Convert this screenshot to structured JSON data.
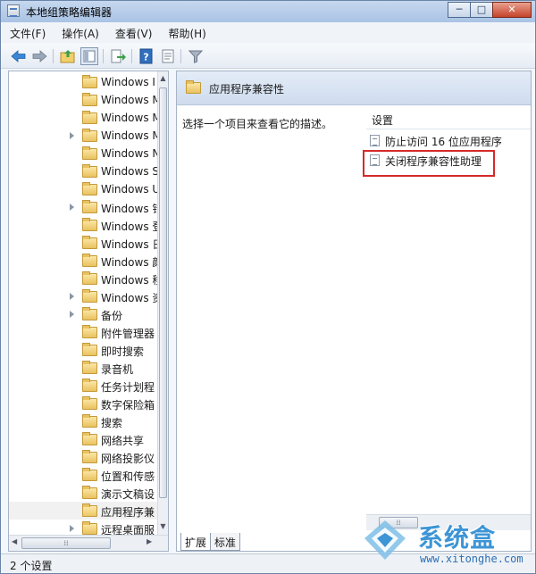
{
  "window": {
    "title": "本地组策略编辑器",
    "buttons": {
      "minimize": "─",
      "maximize": "□",
      "close": "✕"
    }
  },
  "menu": [
    {
      "id": "file",
      "label": "文件(F)"
    },
    {
      "id": "action",
      "label": "操作(A)"
    },
    {
      "id": "view",
      "label": "查看(V)"
    },
    {
      "id": "help",
      "label": "帮助(H)"
    }
  ],
  "toolbar": {
    "icons": [
      "back-arrow-icon",
      "forward-arrow-icon",
      "up-folder-icon",
      "show-hide-tree-icon",
      "export-list-icon",
      "help-icon",
      "properties-icon",
      "filter-icon"
    ]
  },
  "tree": {
    "items": [
      {
        "label": "Windows I",
        "expandable": false
      },
      {
        "label": "Windows M",
        "expandable": false
      },
      {
        "label": "Windows M",
        "expandable": false
      },
      {
        "label": "Windows M",
        "expandable": true
      },
      {
        "label": "Windows N",
        "expandable": false
      },
      {
        "label": "Windows S",
        "expandable": false
      },
      {
        "label": "Windows U",
        "expandable": false
      },
      {
        "label": "Windows 错",
        "expandable": true
      },
      {
        "label": "Windows 登",
        "expandable": false
      },
      {
        "label": "Windows 日",
        "expandable": false
      },
      {
        "label": "Windows 颜",
        "expandable": false
      },
      {
        "label": "Windows 移",
        "expandable": false
      },
      {
        "label": "Windows 资",
        "expandable": true
      },
      {
        "label": "备份",
        "expandable": true
      },
      {
        "label": "附件管理器",
        "expandable": false
      },
      {
        "label": "即时搜索",
        "expandable": false
      },
      {
        "label": "录音机",
        "expandable": false
      },
      {
        "label": "任务计划程",
        "expandable": false
      },
      {
        "label": "数字保险箱",
        "expandable": false
      },
      {
        "label": "搜索",
        "expandable": false
      },
      {
        "label": "网络共享",
        "expandable": false
      },
      {
        "label": "网络投影仪",
        "expandable": false
      },
      {
        "label": "位置和传感",
        "expandable": false
      },
      {
        "label": "演示文稿设",
        "expandable": false
      },
      {
        "label": "应用程序兼",
        "expandable": false,
        "selected": true
      },
      {
        "label": "远程桌面服",
        "expandable": true
      }
    ]
  },
  "right": {
    "header_title": "应用程序兼容性",
    "description": "选择一个项目来查看它的描述。",
    "column_header": "设置",
    "settings": [
      {
        "label": "防止访问 16 位应用程序",
        "highlighted": false
      },
      {
        "label": "关闭程序兼容性助理",
        "highlighted": true
      }
    ],
    "tabs": [
      {
        "label": "扩展",
        "active": true
      },
      {
        "label": "标准",
        "active": false
      }
    ]
  },
  "status": {
    "text": "2 个设置"
  },
  "watermark": {
    "brand": "系统盒",
    "url": "www.xitonghe.com"
  },
  "colors": {
    "highlight": "#d52a2a",
    "accent": "#3d95d6"
  }
}
